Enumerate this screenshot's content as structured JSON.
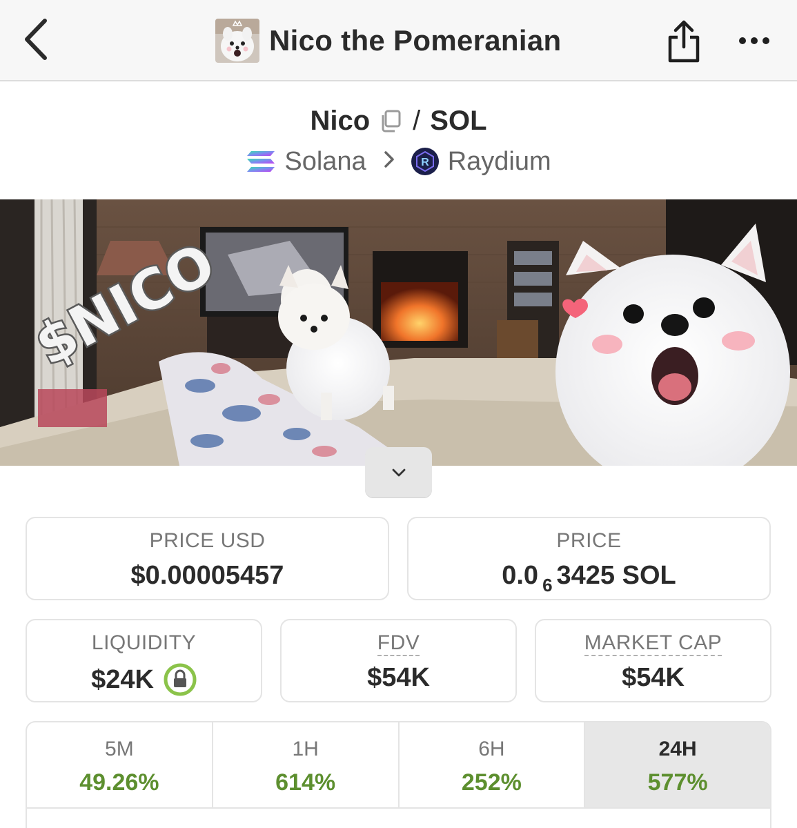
{
  "header": {
    "title": "Nico the Pomeranian",
    "back_icon": "chevron-left-icon",
    "share_icon": "share-icon",
    "more_icon": "more-horizontal-icon"
  },
  "pair": {
    "base": "Nico",
    "separator": "/",
    "quote": "SOL",
    "chain": "Solana",
    "dex": "Raydium"
  },
  "banner": {
    "text": "$NICO"
  },
  "stats": {
    "price_usd": {
      "label": "PRICE USD",
      "value": "$0.00005457"
    },
    "price_native": {
      "label": "PRICE",
      "prefix": "0.0",
      "zeros": "6",
      "suffix": "3425 SOL"
    },
    "liquidity": {
      "label": "LIQUIDITY",
      "value": "$24K"
    },
    "fdv": {
      "label": "FDV",
      "value": "$54K"
    },
    "market_cap": {
      "label": "MARKET CAP",
      "value": "$54K"
    }
  },
  "timeframes": [
    {
      "label": "5M",
      "change": "49.26%"
    },
    {
      "label": "1H",
      "change": "614%"
    },
    {
      "label": "6H",
      "change": "252%"
    },
    {
      "label": "24H",
      "change": "577%",
      "active": true
    }
  ],
  "colors": {
    "positive": "#5d8f2f",
    "lock_ring": "#8bc34a",
    "raydium": "#1b1f4a"
  }
}
